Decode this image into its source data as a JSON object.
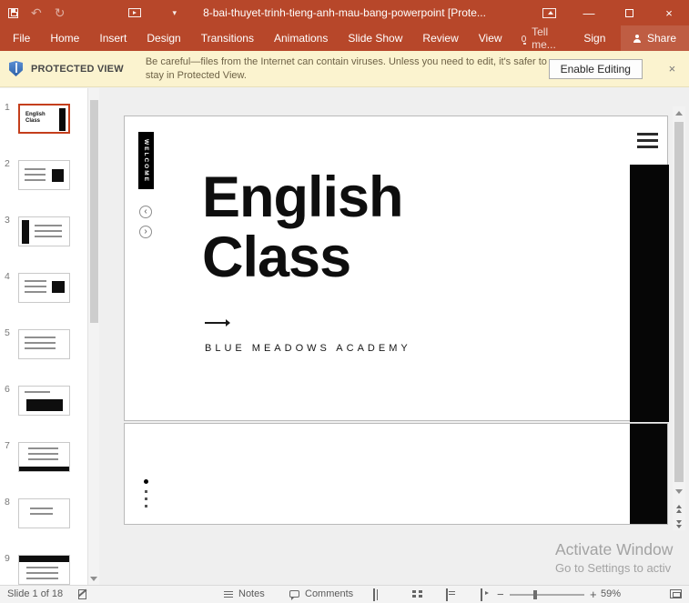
{
  "window": {
    "title": "8-bai-thuyet-trinh-tieng-anh-mau-bang-powerpoint [Prote..."
  },
  "icons": {
    "undo": "↶",
    "redo": "↻",
    "qat_dropdown": "▾",
    "minimize": "—",
    "close": "×",
    "banner_close": "×",
    "prev": "‹",
    "next": "›",
    "zoom_out": "−",
    "zoom_in": "+"
  },
  "ribbon": {
    "tabs": [
      "File",
      "Home",
      "Insert",
      "Design",
      "Transitions",
      "Animations",
      "Slide Show",
      "Review",
      "View"
    ],
    "tell_me": "Tell me...",
    "sign_in": "Sign in",
    "share": "Share"
  },
  "protected_view": {
    "label": "PROTECTED VIEW",
    "message": "Be careful—files from the Internet can contain viruses. Unless you need to edit, it's safer to stay in Protected View.",
    "enable_editing": "Enable Editing"
  },
  "thumbnails": {
    "numbers": [
      "1",
      "2",
      "3",
      "4",
      "5",
      "6",
      "7",
      "8",
      "9"
    ]
  },
  "slide": {
    "welcome_tab": "WELCOME",
    "title": "English Class",
    "subtitle": "BLUE MEADOWS ACADEMY"
  },
  "watermark": {
    "line1": "Activate Window",
    "line2": "Go to Settings to activ"
  },
  "status_bar": {
    "slide_counter": "Slide 1 of 18",
    "notes": "Notes",
    "comments": "Comments",
    "zoom_level": "59%"
  },
  "colors": {
    "brand_red": "#B7472A",
    "banner_yellow": "#FBF3CF",
    "selection_red": "#C43E1C"
  }
}
